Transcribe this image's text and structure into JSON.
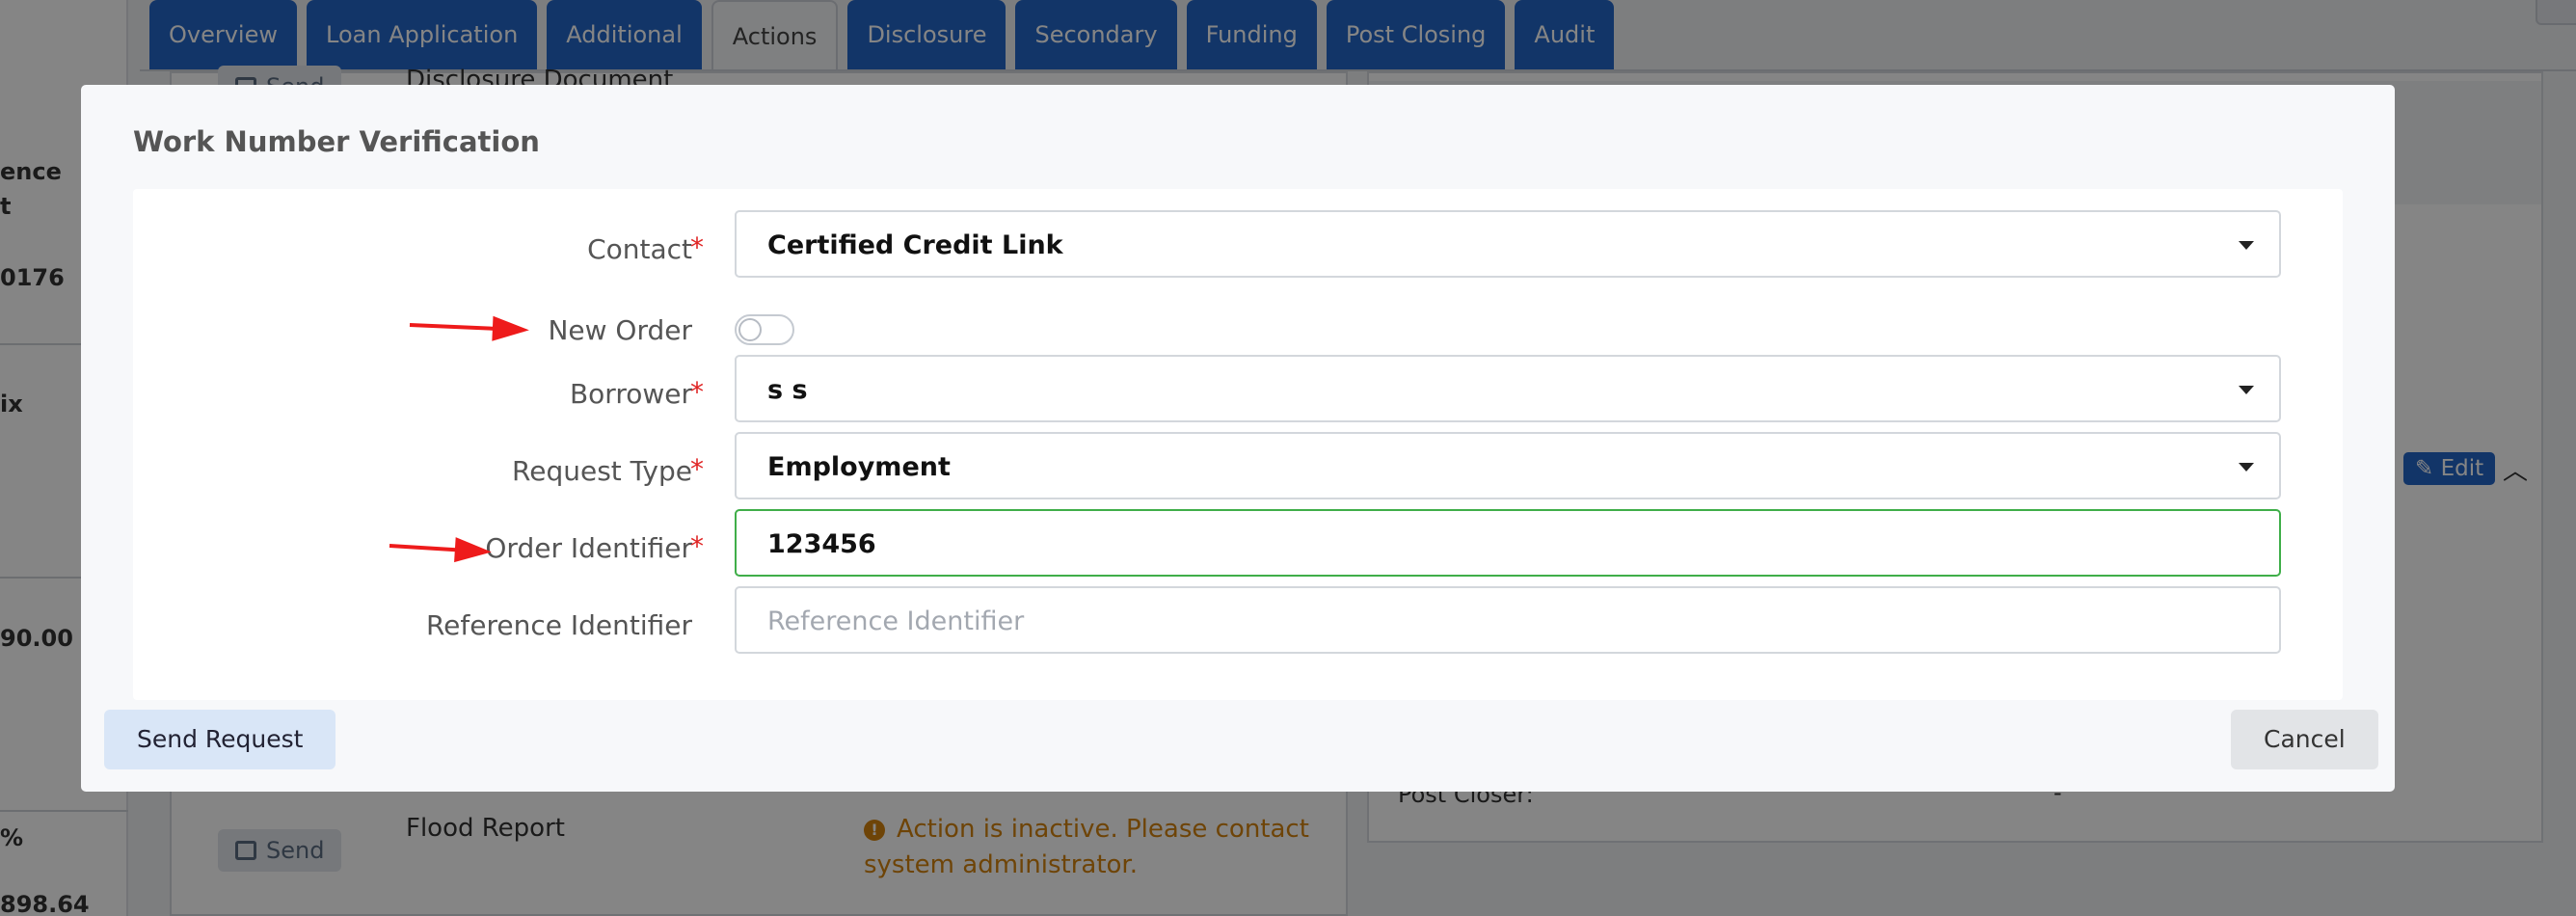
{
  "tabs": [
    "Overview",
    "Loan Application",
    "Additional",
    "Actions",
    "Disclosure",
    "Secondary",
    "Funding",
    "Post Closing",
    "Audit"
  ],
  "left_column": {
    "items": [
      "ence",
      "t",
      "0176",
      "ix",
      "90.00",
      "%",
      "898.64"
    ]
  },
  "background": {
    "send_label": "Send",
    "disclosure_document": "Disclosure Document",
    "flood_report": "Flood Report",
    "warning": "Action is inactive. Please contact system administrator.",
    "edit_label": "Edit",
    "post_closer": "Post Closer:",
    "post_closer_value": "-"
  },
  "modal": {
    "title": "Work Number Verification",
    "fields": {
      "contact": {
        "label": "Contact",
        "value": "Certified Credit Link"
      },
      "new_order": {
        "label": "New Order",
        "on": false
      },
      "borrower": {
        "label": "Borrower",
        "value": "s s"
      },
      "request_type": {
        "label": "Request Type",
        "value": "Employment"
      },
      "order_identifier": {
        "label": "Order Identifier",
        "value": "123456"
      },
      "reference_identifier": {
        "label": "Reference Identifier",
        "placeholder": "Reference Identifier"
      }
    },
    "required_mark": "*",
    "send_request_label": "Send Request",
    "cancel_label": "Cancel"
  },
  "colors": {
    "tab_blue": "#2466c8",
    "required_red": "#e02424",
    "valid_green": "#3fae49",
    "arrow_red": "#ee1b1b",
    "warning_orange": "#d4820f"
  }
}
